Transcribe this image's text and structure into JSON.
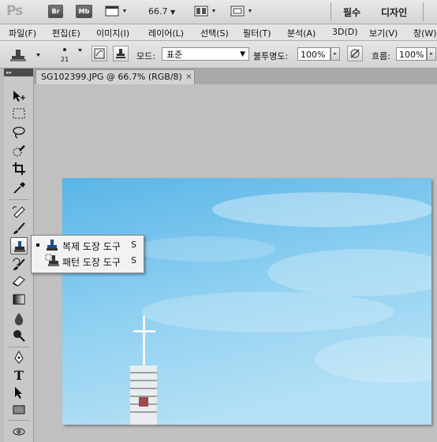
{
  "app": {
    "logo": "Ps",
    "bridge": "Br",
    "mini_bridge": "Mb",
    "zoom": "66.7",
    "workspaces": [
      "필수",
      "디자인"
    ]
  },
  "menu": [
    "파일(F)",
    "편집(E)",
    "이미지(I)",
    "레이어(L)",
    "선택(S)",
    "필터(T)",
    "분석(A)",
    "3D(D)",
    "보기(V)",
    "창(W)"
  ],
  "options": {
    "brush_size": "21",
    "mode_label": "모드:",
    "mode_value": "표준",
    "opacity_label": "불투명도:",
    "opacity_value": "100%",
    "flow_label": "흐름:",
    "flow_value": "100%"
  },
  "document": {
    "tab_title": "SG102399.JPG @ 66.7% (RGB/8)",
    "close": "×"
  },
  "toolbox": {
    "collapse": "▸▸"
  },
  "flyout": {
    "items": [
      {
        "label": "복제 도장 도구",
        "key": "S",
        "selected": true
      },
      {
        "label": "패턴 도장 도구",
        "key": "S",
        "selected": false
      }
    ]
  },
  "colors": {
    "sky_top": "#5cb8e8",
    "sky_bottom": "#a9dcf3",
    "chrome": "#d4d4d4",
    "toolbox_head": "#4b4b4b"
  }
}
